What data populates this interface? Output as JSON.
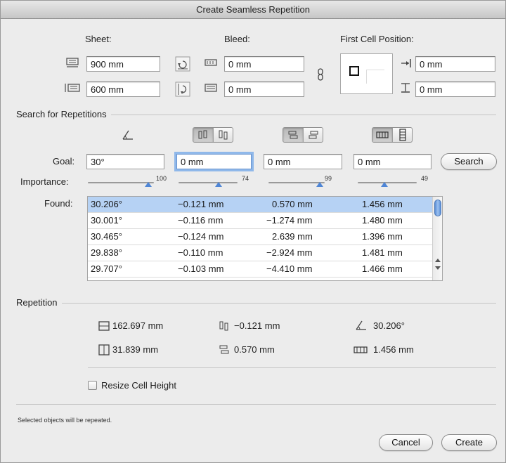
{
  "window": {
    "title": "Create Seamless Repetition"
  },
  "sheet": {
    "label": "Sheet:",
    "width_value": "900 mm",
    "height_value": "600 mm"
  },
  "bleed": {
    "label": "Bleed:",
    "horizontal_value": "0 mm",
    "vertical_value": "0 mm"
  },
  "first_cell": {
    "label": "First Cell Position:",
    "x_value": "0 mm",
    "y_value": "0 mm"
  },
  "search": {
    "section_label": "Search for Repetitions",
    "goal_label": "Goal:",
    "goal_values": [
      "30°",
      "0 mm",
      "0 mm",
      "0 mm"
    ],
    "search_button": "Search",
    "importance_label": "Importance:",
    "importance_values": [
      100,
      74,
      99,
      49
    ],
    "importance_labels": [
      "100",
      "74",
      "99",
      "49"
    ],
    "found_label": "Found:",
    "results": [
      [
        "30.206°",
        "−0.121 mm",
        "0.570 mm",
        "1.456 mm"
      ],
      [
        "30.001°",
        "−0.116 mm",
        "−1.274 mm",
        "1.480 mm"
      ],
      [
        "30.465°",
        "−0.124 mm",
        "2.639 mm",
        "1.396 mm"
      ],
      [
        "29.838°",
        "−0.110 mm",
        "−2.924 mm",
        "1.481 mm"
      ],
      [
        "29.707°",
        "−0.103 mm",
        "−4.410 mm",
        "1.466 mm"
      ]
    ]
  },
  "repetition": {
    "section_label": "Repetition",
    "width": "162.697 mm",
    "height": "31.839 mm",
    "shift_v": "−0.121 mm",
    "shift_h": "0.570 mm",
    "angle": "30.206°",
    "spacing": "1.456 mm",
    "resize_label": "Resize Cell Height"
  },
  "footer": {
    "status": "Selected objects will be repeated.",
    "cancel": "Cancel",
    "create": "Create"
  },
  "colors": {
    "selection": "#b6d2f4",
    "accent": "#4f86d6",
    "window_bg": "#ececec"
  }
}
